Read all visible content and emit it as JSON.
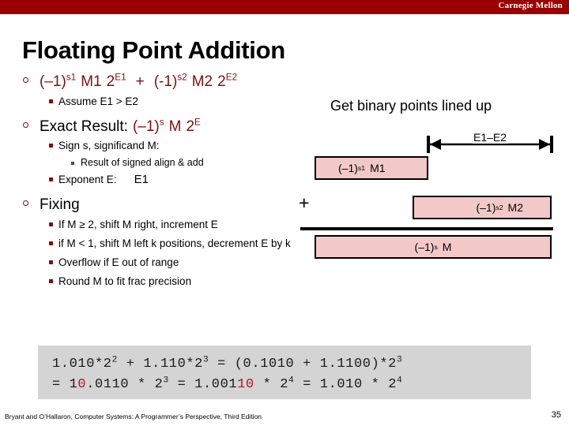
{
  "banner": {
    "brand": "Carnegie Mellon",
    "color": "#990000"
  },
  "slide": {
    "title": "Floating Point Addition"
  },
  "body": {
    "bullet1": {
      "expr_a_base": "(–1)",
      "expr_a_sup": "s1",
      "expr_a_m": "M1",
      "expr_a_pow_base": "2",
      "expr_a_pow_sup": "E1",
      "operator": "+",
      "expr_b_base": "(-1)",
      "expr_b_sup": "s2",
      "expr_b_m": "M2",
      "expr_b_pow_base": "2",
      "expr_b_pow_sup": "E2",
      "sub": "Assume E1 > E2"
    },
    "bullet2": {
      "label": "Exact Result:",
      "expr_base": "(–1)",
      "expr_sup": "s",
      "expr_m": "M",
      "expr_pow_base": "2",
      "expr_pow_sup": "E",
      "sub1": "Sign s, significand M:",
      "sub1_detail": "Result of signed align & add",
      "sub2_label": "Exponent E:",
      "sub2_value": "E1"
    },
    "bullet3": {
      "label": "Fixing",
      "sub1": "If M ≥ 2, shift M right, increment E",
      "sub2": "if M < 1, shift M left k positions, decrement E by k",
      "sub3": "Overflow if E out of range",
      "sub4": "Round M to fit frac precision"
    }
  },
  "diagram": {
    "caption": "Get binary points lined up",
    "measure_label": "E1–E2",
    "plus": "+",
    "box_m1_base": "(–1)",
    "box_m1_sup": "s1",
    "box_m1_m": "M1",
    "box_m2_base": "(–1)",
    "box_m2_sup": "s2",
    "box_m2_m": "M2",
    "box_result_base": "(–1)",
    "box_result_sup": "s",
    "box_result_m": "M",
    "box_fill": "#f2c8c8"
  },
  "code": {
    "line1_a": "1.010*2",
    "line1_a_sup": "2",
    "line1_b": " + 1.110*2",
    "line1_b_sup": "3",
    "line1_c": " = (0.1010 + 1.1100)*2",
    "line1_c_sup": "3",
    "line2_a": "= 1",
    "line2_red1": "0",
    "line2_b": ".0110 * 2",
    "line2_b_sup": "3",
    "line2_c": " = 1.001",
    "line2_red2": "10",
    "line2_d": " * 2",
    "line2_d_sup": "4",
    "line2_e": " = 1.010 * 2",
    "line2_e_sup": "4",
    "highlight_color": "#b01818"
  },
  "footer": {
    "citation": "Bryant and O’Hallaron, Computer Systems: A Programmer’s Perspective, Third Edition",
    "page": "35"
  }
}
